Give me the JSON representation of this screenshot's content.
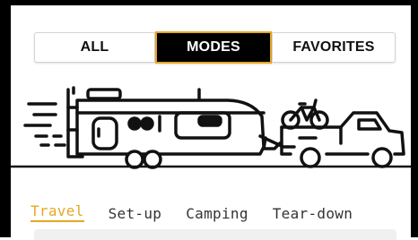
{
  "mode_selector": {
    "options": [
      "ALL",
      "MODES",
      "FAVORITES"
    ],
    "selected": "MODES",
    "selected_border_color": "#e5a823"
  },
  "illustration": {
    "icon": "rv-trailer-towed-by-pickup-with-bike-rack"
  },
  "tabs": {
    "items": [
      "Travel",
      "Set-up",
      "Camping",
      "Tear-down"
    ],
    "active": "Travel",
    "active_color": "#e5a823"
  }
}
